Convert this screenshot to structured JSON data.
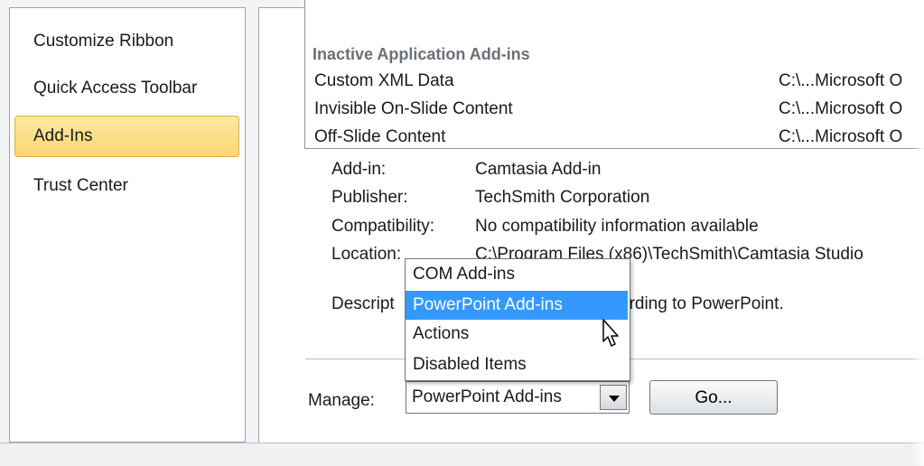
{
  "nav": {
    "items": [
      {
        "label": "Customize Ribbon"
      },
      {
        "label": "Quick Access Toolbar"
      },
      {
        "label": "Add-Ins"
      },
      {
        "label": "Trust Center"
      }
    ],
    "selected_index": 2
  },
  "addins_list": {
    "section_header": "Inactive Application Add-ins",
    "rows": [
      {
        "name": "Custom XML Data",
        "location": "C:\\...Microsoft O"
      },
      {
        "name": "Invisible On-Slide Content",
        "location": "C:\\...Microsoft O"
      },
      {
        "name": "Off-Slide Content",
        "location": "C:\\...Microsoft O"
      }
    ]
  },
  "details": {
    "addin_label": "Add-in:",
    "addin_value": "Camtasia Add-in",
    "publisher_label": "Publisher:",
    "publisher_value": "TechSmith Corporation",
    "compat_label": "Compatibility:",
    "compat_value": "No compatibility information available",
    "location_label": "Location:",
    "location_value": "C:\\Program Files (x86)\\TechSmith\\Camtasia Studio",
    "description_label": "Descript",
    "description_value": "ording to PowerPoint."
  },
  "manage": {
    "label": "Manage:",
    "selected": "PowerPoint Add-ins",
    "go_label": "Go...",
    "options": [
      "COM Add-ins",
      "PowerPoint Add-ins",
      "Actions",
      "Disabled Items"
    ],
    "highlighted_index": 1
  },
  "colors": {
    "highlight": "#3399ff",
    "nav_selected": "#fbd673"
  },
  "icons": {
    "cursor": "mouse-pointer-icon",
    "dropdown_arrow": "chevron-down-icon"
  }
}
